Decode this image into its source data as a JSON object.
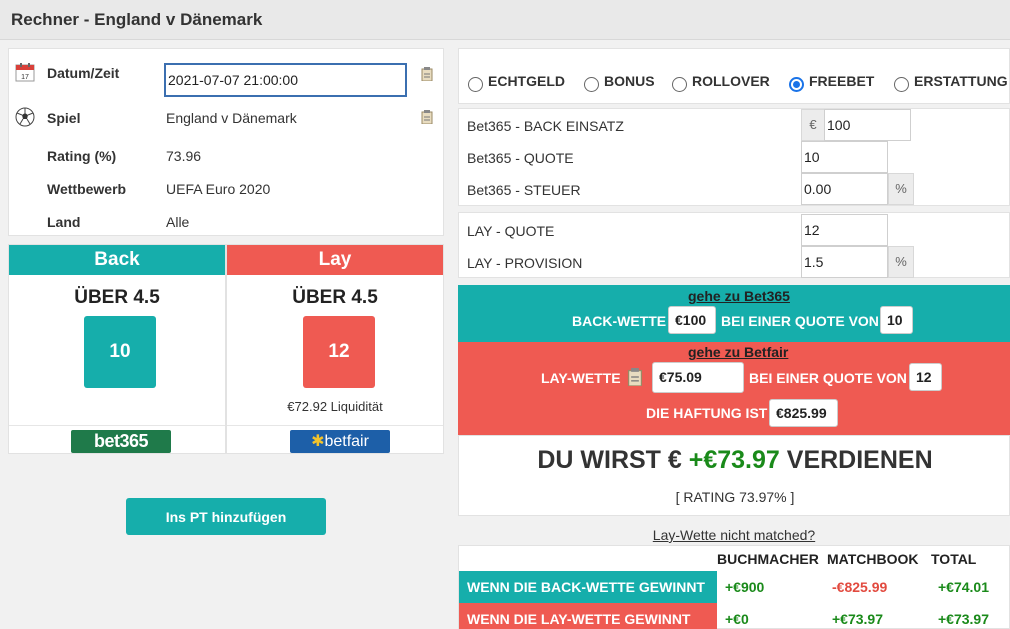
{
  "page_title": "Rechner - England v Dänemark",
  "info": {
    "datetime_label": "Datum/Zeit",
    "datetime_value": "2021-07-07 21:00:00",
    "match_label": "Spiel",
    "match_value": "England v Dänemark",
    "rating_label": "Rating (%)",
    "rating_value": "73.96",
    "competition_label": "Wettbewerb",
    "competition_value": "UEFA Euro 2020",
    "country_label": "Land",
    "country_value": "Alle"
  },
  "back": {
    "header": "Back",
    "market": "ÜBER 4.5",
    "odds": "10",
    "logo": "bet365"
  },
  "lay": {
    "header": "Lay",
    "market": "ÜBER 4.5",
    "odds": "12",
    "liquidity": "€72.92 Liquidität",
    "logo": "betfair"
  },
  "add_button": "Ins PT hinzufügen",
  "bet_types": [
    {
      "label": "ECHTGELD",
      "selected": false
    },
    {
      "label": "BONUS",
      "selected": false
    },
    {
      "label": "ROLLOVER",
      "selected": false
    },
    {
      "label": "FREEBET",
      "selected": true
    },
    {
      "label": "ERSTATTUNG",
      "selected": false
    }
  ],
  "back_fields": {
    "stake_label": "Bet365 - BACK EINSATZ",
    "currency": "€",
    "stake_value": "100",
    "odds_label": "Bet365 - QUOTE",
    "odds_value": "10",
    "tax_label": "Bet365 - STEUER",
    "tax_value": "0.00",
    "percent": "%"
  },
  "lay_fields": {
    "odds_label": "LAY - QUOTE",
    "odds_value": "12",
    "commission_label": "LAY - PROVISION",
    "commission_value": "1.5",
    "percent": "%"
  },
  "back_instruction": {
    "link": "gehe zu Bet365",
    "bet_label": "BACK-WETTE",
    "stake": "€100",
    "odds_text": "BEI EINER QUOTE VON",
    "odds": "10"
  },
  "lay_instruction": {
    "link": "gehe zu Betfair",
    "bet_label": "LAY-WETTE",
    "stake": "€75.09",
    "odds_text": "BEI EINER QUOTE VON",
    "odds": "12",
    "liability_label": "DIE HAFTUNG IST",
    "liability": "€825.99"
  },
  "result": {
    "prefix": "DU WIRST €",
    "amount": "+€73.97",
    "suffix": "VERDIENEN",
    "rating": "[ RATING 73.97% ]"
  },
  "not_matched_link": "Lay-Wette nicht matched?",
  "outcomes": {
    "headers": [
      "BUCHMACHER",
      "MATCHBOOK",
      "TOTAL"
    ],
    "rows": [
      {
        "label": "WENN DIE BACK-WETTE GEWINNT",
        "bookmaker": "+€900",
        "matchbook": "-€825.99",
        "total": "+€74.01"
      },
      {
        "label": "WENN DIE LAY-WETTE GEWINNT",
        "bookmaker": "+€0",
        "matchbook": "+€73.97",
        "total": "+€73.97"
      }
    ]
  },
  "colors": {
    "back": "#16aeab",
    "lay": "#ef5a52",
    "profit": "#1a8a1a",
    "loss": "#e24a3f"
  }
}
